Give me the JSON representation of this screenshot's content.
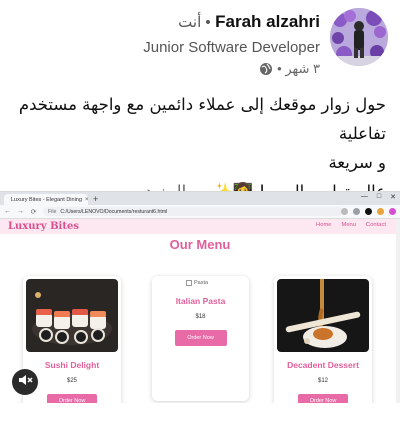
{
  "post": {
    "author_name": "Farah alzahri",
    "author_relation": "• أنت",
    "author_title": "Junior Software Developer",
    "time": "٣ شهر •",
    "visibility_icon": "globe-icon",
    "text_line1": "حول زوار موقعك إلى عملاء دائمين مع واجهة مستخدم تفاعلية",
    "text_line2": "و سريعة",
    "text_line3": "عالم تطوير الويب! 👩‍💻✨",
    "more_label": "... المزيد"
  },
  "browser": {
    "tab_title": "Luxury Bites - Elegant Dining",
    "tab_close": "×",
    "new_tab": "+",
    "window_controls": [
      "—",
      "□",
      "✕"
    ],
    "back": "←",
    "forward": "→",
    "reload": "⟳",
    "url_scheme": "File",
    "url": "C:/Users/LENOVO/Documents/resturant6.html"
  },
  "site": {
    "logo": "Luxury Bites",
    "menu_items": [
      "Home",
      "Menu",
      "Contact"
    ],
    "heading": "Our Menu",
    "cards": [
      {
        "name": "Sushi Delight",
        "price": "$25",
        "button": "Order Now",
        "image": "sushi"
      },
      {
        "name": "Italian Pasta",
        "price": "$18",
        "button": "Order Now",
        "image_alt": "Pasta"
      },
      {
        "name": "Decadent Dessert",
        "price": "$12",
        "button": "Order Now",
        "image": "dessert"
      }
    ]
  },
  "colors": {
    "accent_pink": "#e0609b",
    "button_pink": "#e86aa6",
    "nav_bg": "#fde8f1"
  },
  "controls": {
    "mute_icon": "speaker-muted-icon"
  }
}
